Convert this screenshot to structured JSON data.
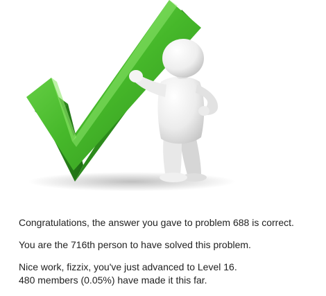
{
  "illustration": {
    "name": "checkmark-with-3d-figure",
    "checkmark_color": "#44b52a",
    "figure_color": "#f2f2f2"
  },
  "messages": {
    "correct": "Congratulations, the answer you gave to problem 688 is correct.",
    "rank": "You are the 716th person to have solved this problem.",
    "level_up": "Nice work, fizzix, you've just advanced to Level 16.",
    "members": "480 members (0.05%) have made it this far."
  }
}
